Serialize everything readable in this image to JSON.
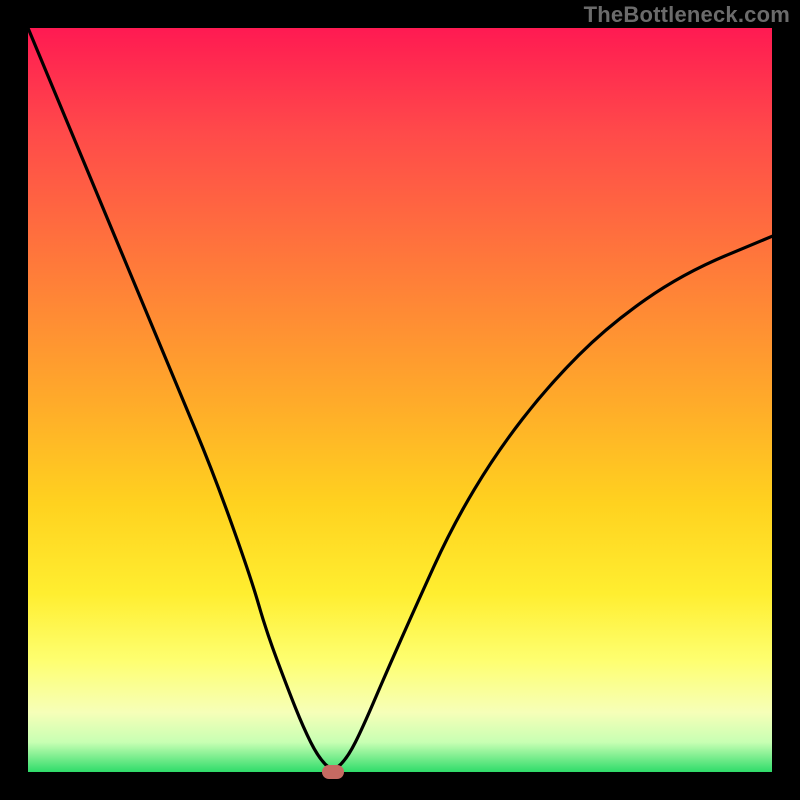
{
  "watermark": "TheBottleneck.com",
  "chart_data": {
    "type": "line",
    "title": "",
    "xlabel": "",
    "ylabel": "",
    "xlim": [
      0,
      100
    ],
    "ylim": [
      0,
      100
    ],
    "grid": false,
    "legend": false,
    "background_gradient": {
      "orientation": "vertical",
      "stops": [
        {
          "pos": 0,
          "color": "#ff1a52",
          "meaning": "worst"
        },
        {
          "pos": 50,
          "color": "#ffaa2a"
        },
        {
          "pos": 76,
          "color": "#ffee30"
        },
        {
          "pos": 100,
          "color": "#2fdc6a",
          "meaning": "best"
        }
      ]
    },
    "series": [
      {
        "name": "bottleneck-curve",
        "x": [
          0,
          5,
          10,
          15,
          20,
          25,
          30,
          32,
          35,
          37,
          39,
          41,
          43,
          45,
          48,
          52,
          57,
          63,
          70,
          78,
          88,
          100
        ],
        "y": [
          100,
          88,
          76,
          64,
          52,
          40,
          26,
          19,
          11,
          6,
          2,
          0,
          2,
          6,
          13,
          22,
          33,
          43,
          52,
          60,
          67,
          72
        ]
      }
    ],
    "marker": {
      "x": 41,
      "y": 0,
      "color": "#c66a62"
    }
  }
}
